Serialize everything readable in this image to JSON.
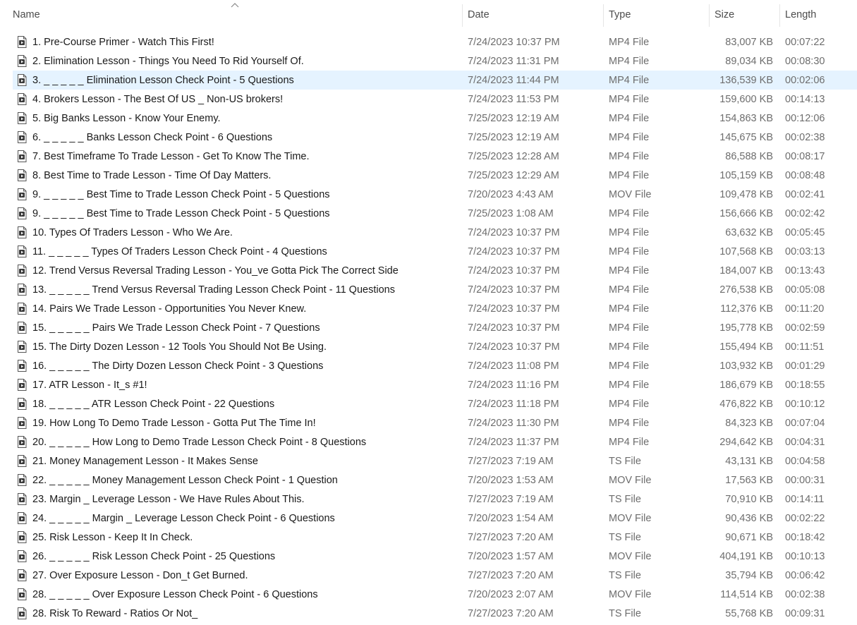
{
  "columns": {
    "name": "Name",
    "date": "Date",
    "type": "Type",
    "size": "Size",
    "length": "Length"
  },
  "selected_index": 2,
  "colors": {
    "selection": "#e5f3ff",
    "header_text": "#4c4c4c",
    "secondary_text": "#6d6d6d"
  },
  "files": [
    {
      "name": "1. Pre-Course Primer - Watch This First!",
      "date": "7/24/2023 10:37 PM",
      "type": "MP4 File",
      "size": "83,007 KB",
      "length": "00:07:22"
    },
    {
      "name": "2. Elimination Lesson - Things You Need To Rid Yourself Of.",
      "date": "7/24/2023 11:31 PM",
      "type": "MP4 File",
      "size": "89,034 KB",
      "length": "00:08:30"
    },
    {
      "name": "3. _ _ _ _ _ Elimination Lesson Check Point - 5 Questions",
      "date": "7/24/2023 11:44 PM",
      "type": "MP4 File",
      "size": "136,539 KB",
      "length": "00:02:06"
    },
    {
      "name": "4. Brokers Lesson - The Best Of US _ Non-US brokers!",
      "date": "7/24/2023 11:53 PM",
      "type": "MP4 File",
      "size": "159,600 KB",
      "length": "00:14:13"
    },
    {
      "name": "5. Big Banks Lesson - Know Your Enemy.",
      "date": "7/25/2023 12:19 AM",
      "type": "MP4 File",
      "size": "154,863 KB",
      "length": "00:12:06"
    },
    {
      "name": "6. _ _ _ _ _ Banks Lesson Check Point - 6 Questions",
      "date": "7/25/2023 12:19 AM",
      "type": "MP4 File",
      "size": "145,675 KB",
      "length": "00:02:38"
    },
    {
      "name": "7. Best Timeframe To Trade Lesson - Get To Know The Time.",
      "date": "7/25/2023 12:28 AM",
      "type": "MP4 File",
      "size": "86,588 KB",
      "length": "00:08:17"
    },
    {
      "name": "8. Best Time to Trade Lesson - Time Of Day Matters.",
      "date": "7/25/2023 12:29 AM",
      "type": "MP4 File",
      "size": "105,159 KB",
      "length": "00:08:48"
    },
    {
      "name": "9. _ _ _ _ _ Best Time to Trade Lesson Check Point - 5 Questions",
      "date": "7/20/2023 4:43 AM",
      "type": "MOV File",
      "size": "109,478 KB",
      "length": "00:02:41"
    },
    {
      "name": "9. _ _ _ _ _ Best Time to Trade Lesson Check Point - 5 Questions",
      "date": "7/25/2023 1:08 AM",
      "type": "MP4 File",
      "size": "156,666 KB",
      "length": "00:02:42"
    },
    {
      "name": "10. Types Of Traders Lesson - Who We Are.",
      "date": "7/24/2023 10:37 PM",
      "type": "MP4 File",
      "size": "63,632 KB",
      "length": "00:05:45"
    },
    {
      "name": "11. _ _ _ _ _ Types Of Traders Lesson Check Point - 4 Questions",
      "date": "7/24/2023 10:37 PM",
      "type": "MP4 File",
      "size": "107,568 KB",
      "length": "00:03:13"
    },
    {
      "name": "12. Trend Versus Reversal Trading Lesson - You_ve Gotta Pick The Correct Side",
      "date": "7/24/2023 10:37 PM",
      "type": "MP4 File",
      "size": "184,007 KB",
      "length": "00:13:43"
    },
    {
      "name": "13. _ _ _ _ _ Trend Versus Reversal Trading Lesson Check Point - 11 Questions",
      "date": "7/24/2023 10:37 PM",
      "type": "MP4 File",
      "size": "276,538 KB",
      "length": "00:05:08"
    },
    {
      "name": "14. Pairs We Trade Lesson - Opportunities You Never Knew.",
      "date": "7/24/2023 10:37 PM",
      "type": "MP4 File",
      "size": "112,376 KB",
      "length": "00:11:20"
    },
    {
      "name": "15. _ _ _ _ _ Pairs We Trade Lesson Check Point - 7 Questions",
      "date": "7/24/2023 10:37 PM",
      "type": "MP4 File",
      "size": "195,778 KB",
      "length": "00:02:59"
    },
    {
      "name": "15. The Dirty Dozen Lesson - 12 Tools You Should Not Be Using.",
      "date": "7/24/2023 10:37 PM",
      "type": "MP4 File",
      "size": "155,494 KB",
      "length": "00:11:51"
    },
    {
      "name": "16.  _ _ _ _ _ The Dirty Dozen Lesson Check Point - 3 Questions",
      "date": "7/24/2023 11:08 PM",
      "type": "MP4 File",
      "size": "103,932 KB",
      "length": "00:01:29"
    },
    {
      "name": "17. ATR Lesson - It_s #1!",
      "date": "7/24/2023 11:16 PM",
      "type": "MP4 File",
      "size": "186,679 KB",
      "length": "00:18:55"
    },
    {
      "name": "18. _ _ _ _ _ ATR Lesson Check Point - 22 Questions",
      "date": "7/24/2023 11:18 PM",
      "type": "MP4 File",
      "size": "476,822 KB",
      "length": "00:10:12"
    },
    {
      "name": "19. How Long To Demo Trade Lesson - Gotta Put The Time In!",
      "date": "7/24/2023 11:30 PM",
      "type": "MP4 File",
      "size": "84,323 KB",
      "length": "00:07:04"
    },
    {
      "name": "20.  _ _ _ _ _ How Long to Demo Trade Lesson Check Point - 8 Questions",
      "date": "7/24/2023 11:37 PM",
      "type": "MP4 File",
      "size": "294,642 KB",
      "length": "00:04:31"
    },
    {
      "name": "21. Money Management Lesson - It Makes Sense",
      "date": "7/27/2023 7:19 AM",
      "type": "TS File",
      "size": "43,131 KB",
      "length": "00:04:58"
    },
    {
      "name": "22.  _ _ _ _ _ Money Management Lesson Check Point - 1 Question",
      "date": "7/20/2023 1:53 AM",
      "type": "MOV File",
      "size": "17,563 KB",
      "length": "00:00:31"
    },
    {
      "name": "23. Margin _ Leverage Lesson - We Have Rules About This.",
      "date": "7/27/2023 7:19 AM",
      "type": "TS File",
      "size": "70,910 KB",
      "length": "00:14:11"
    },
    {
      "name": "24. _ _ _ _ _ Margin _ Leverage Lesson Check Point - 6 Questions",
      "date": "7/20/2023 1:54 AM",
      "type": "MOV File",
      "size": "90,436 KB",
      "length": "00:02:22"
    },
    {
      "name": "25. Risk Lesson - Keep It In Check.",
      "date": "7/27/2023 7:20 AM",
      "type": "TS File",
      "size": "90,671 KB",
      "length": "00:18:42"
    },
    {
      "name": "26.  _ _ _ _ _ Risk Lesson Check Point - 25 Questions",
      "date": "7/20/2023 1:57 AM",
      "type": "MOV File",
      "size": "404,191 KB",
      "length": "00:10:13"
    },
    {
      "name": "27. Over Exposure Lesson - Don_t Get Burned.",
      "date": "7/27/2023 7:20 AM",
      "type": "TS File",
      "size": "35,794 KB",
      "length": "00:06:42"
    },
    {
      "name": "28. _ _ _ _ _ Over Exposure Lesson Check Point - 6 Questions",
      "date": "7/20/2023 2:07 AM",
      "type": "MOV File",
      "size": "114,514 KB",
      "length": "00:02:38"
    },
    {
      "name": "28. Risk To Reward - Ratios Or Not_",
      "date": "7/27/2023 7:20 AM",
      "type": "TS File",
      "size": "55,768 KB",
      "length": "00:09:31"
    }
  ]
}
